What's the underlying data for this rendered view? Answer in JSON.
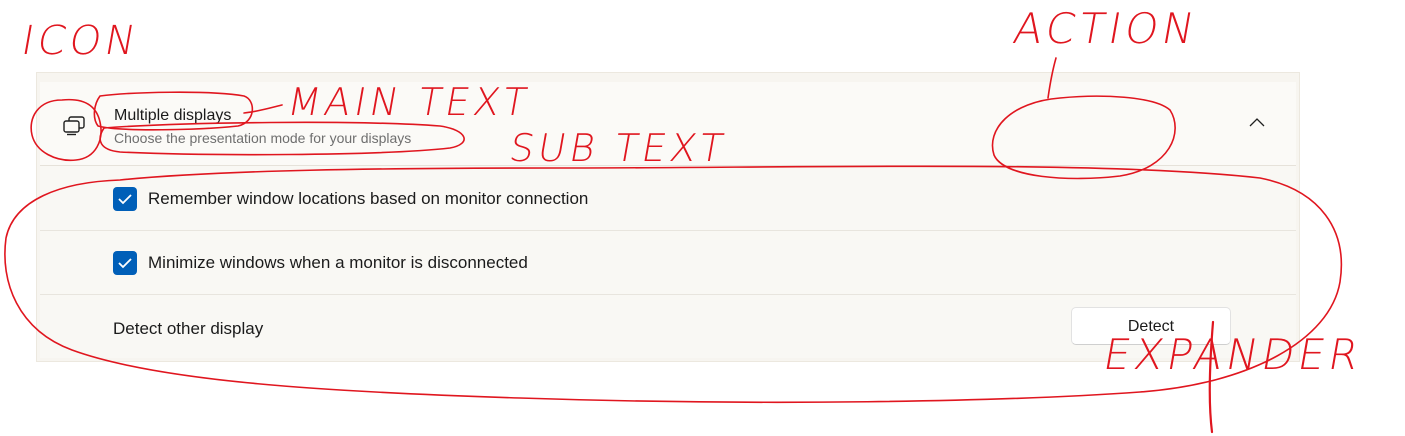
{
  "settings_card": {
    "header": {
      "title": "Multiple displays",
      "subtitle": "Choose the presentation mode for your displays",
      "icon": "multiple-displays-icon",
      "expand_state_icon": "chevron-up-icon"
    },
    "options": [
      {
        "label": "Remember window locations based on monitor connection",
        "checked": true
      },
      {
        "label": "Minimize windows when a monitor is disconnected",
        "checked": true
      }
    ],
    "detect_row": {
      "label": "Detect other display",
      "button_label": "Detect"
    },
    "accent_color": "#005fb8"
  },
  "annotations": {
    "icon_label": "ICON",
    "main_text_label": "MAIN TEXT",
    "sub_text_label": "SUB TEXT",
    "action_label": "ACTION",
    "expander_label": "EXPANDER",
    "ink_color": "#e0161f"
  }
}
